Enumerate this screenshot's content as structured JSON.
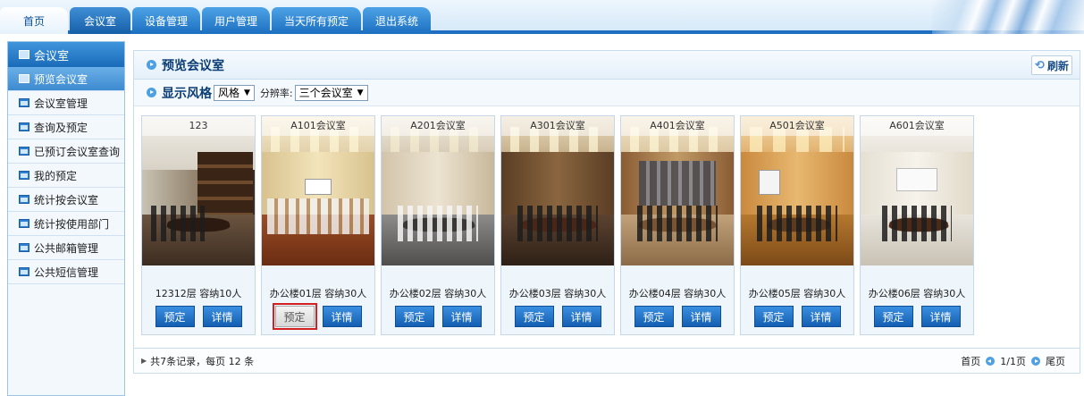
{
  "tabs": [
    {
      "label": "首页",
      "active": true
    },
    {
      "label": "会议室",
      "active": false
    },
    {
      "label": "设备管理",
      "active": false
    },
    {
      "label": "用户管理",
      "active": false
    },
    {
      "label": "当天所有预定",
      "active": false
    },
    {
      "label": "退出系统",
      "active": false
    }
  ],
  "sidebar": {
    "header": "会议室",
    "items": [
      {
        "label": "预览会议室",
        "active": true
      },
      {
        "label": "会议室管理",
        "active": false
      },
      {
        "label": "查询及预定",
        "active": false
      },
      {
        "label": "已预订会议室查询",
        "active": false
      },
      {
        "label": "我的预定",
        "active": false
      },
      {
        "label": "统计按会议室",
        "active": false
      },
      {
        "label": "统计按使用部门",
        "active": false
      },
      {
        "label": "公共邮箱管理",
        "active": false
      },
      {
        "label": "公共短信管理",
        "active": false
      }
    ]
  },
  "main": {
    "title": "预览会议室",
    "refresh_label": "刷新",
    "filter_title": "显示风格",
    "style_select": "风格",
    "resolution_label": "分辨率:",
    "resolution_select": "三个会议室"
  },
  "rooms": [
    {
      "name": "123",
      "info": "12312层 容纳10人",
      "book": "预定",
      "detail": "详情",
      "book_disabled": false
    },
    {
      "name": "A101会议室",
      "info": "办公楼01层 容纳30人",
      "book": "预定",
      "detail": "详情",
      "book_disabled": true
    },
    {
      "name": "A201会议室",
      "info": "办公楼02层 容纳30人",
      "book": "预定",
      "detail": "详情",
      "book_disabled": false
    },
    {
      "name": "A301会议室",
      "info": "办公楼03层 容纳30人",
      "book": "预定",
      "detail": "详情",
      "book_disabled": false
    },
    {
      "name": "A401会议室",
      "info": "办公楼04层 容纳30人",
      "book": "预定",
      "detail": "详情",
      "book_disabled": false
    },
    {
      "name": "A501会议室",
      "info": "办公楼05层 容纳30人",
      "book": "预定",
      "detail": "详情",
      "book_disabled": false
    },
    {
      "name": "A601会议室",
      "info": "办公楼06层 容纳30人",
      "book": "预定",
      "detail": "详情",
      "book_disabled": false
    }
  ],
  "footer": {
    "summary": "共7条记录，每页 12 条",
    "first": "首页",
    "page": "1/1页",
    "last": "尾页"
  },
  "colors": {
    "accent": "#1e6fc2",
    "highlight_border": "#d42020"
  }
}
